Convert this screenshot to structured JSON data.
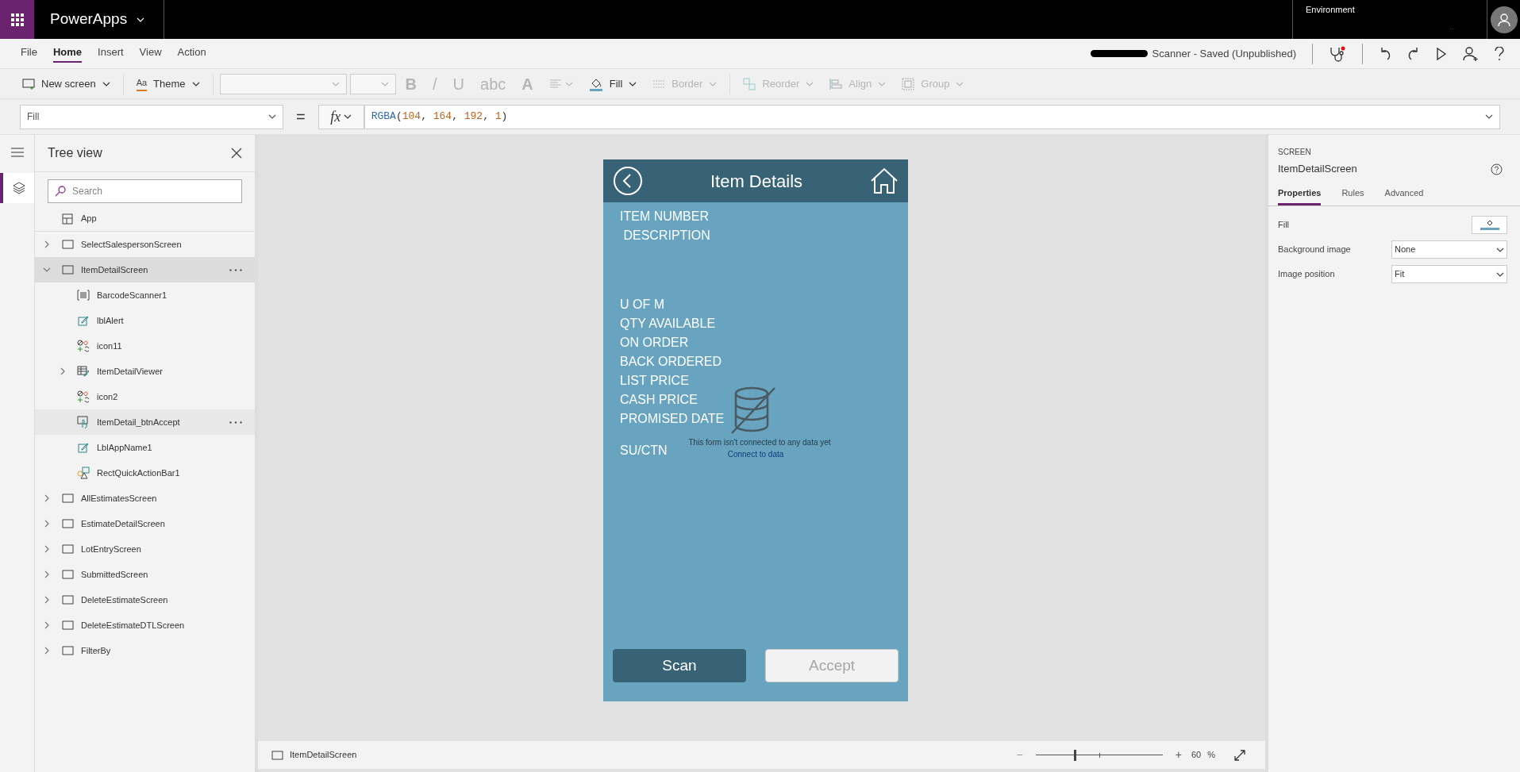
{
  "app_bar": {
    "title": "PowerApps",
    "environment_label": "Environment",
    "environment_value": "..."
  },
  "menu": [
    {
      "label": "File",
      "selected": false
    },
    {
      "label": "Home",
      "selected": true
    },
    {
      "label": "Insert",
      "selected": false
    },
    {
      "label": "View",
      "selected": false
    },
    {
      "label": "Action",
      "selected": false
    }
  ],
  "save_status": "Scanner - Saved (Unpublished)",
  "toolbar": [
    {
      "kind": "new-screen",
      "label": "New screen",
      "disabled": false
    },
    {
      "kind": "theme",
      "label": "Theme",
      "icon_text": "Aa",
      "disabled": false
    },
    {
      "kind": "font-select",
      "disabled": true
    },
    {
      "kind": "size-select",
      "disabled": true
    },
    {
      "kind": "glyph",
      "label": "B",
      "disabled": true
    },
    {
      "kind": "glyph",
      "label": "/",
      "disabled": true
    },
    {
      "kind": "glyph",
      "label": "U",
      "disabled": true
    },
    {
      "kind": "glyph",
      "label": "abc",
      "disabled": true
    },
    {
      "kind": "glyph",
      "label": "A",
      "disabled": true
    },
    {
      "kind": "align-text",
      "disabled": true
    },
    {
      "kind": "fill",
      "label": "Fill",
      "disabled": false
    },
    {
      "kind": "border",
      "label": "Border",
      "disabled": true
    },
    {
      "kind": "reorder",
      "label": "Reorder",
      "disabled": true
    },
    {
      "kind": "align",
      "label": "Align",
      "disabled": true
    },
    {
      "kind": "group",
      "label": "Group",
      "disabled": true
    }
  ],
  "formula_bar": {
    "property": "Fill",
    "equals": "=",
    "fx": "fx",
    "formula": [
      {
        "text": "RGBA",
        "kind": "function"
      },
      {
        "text": "(",
        "kind": "punct"
      },
      {
        "text": "104",
        "kind": "number"
      },
      {
        "text": ", ",
        "kind": "punct"
      },
      {
        "text": "164",
        "kind": "number"
      },
      {
        "text": ", ",
        "kind": "punct"
      },
      {
        "text": "192",
        "kind": "number"
      },
      {
        "text": ", ",
        "kind": "punct"
      },
      {
        "text": "1",
        "kind": "number"
      },
      {
        "text": ")",
        "kind": "punct"
      }
    ]
  },
  "tree_view": {
    "title": "Tree view",
    "search_placeholder": "Search",
    "items": [
      {
        "label": "App",
        "kind": "app",
        "selected": false,
        "hovered": false
      },
      {
        "label": "SelectSalespersonScreen",
        "kind": "screen",
        "expanded": false,
        "selected": false,
        "hovered": false
      },
      {
        "label": "ItemDetailScreen",
        "kind": "screen",
        "expanded": true,
        "selected": true,
        "hovered": false,
        "children": [
          {
            "label": "BarcodeScanner1",
            "kind": "barcode",
            "selected": false,
            "hovered": false
          },
          {
            "label": "lblAlert",
            "kind": "label",
            "selected": false,
            "hovered": false
          },
          {
            "label": "icon11",
            "kind": "icons",
            "selected": false,
            "hovered": false
          },
          {
            "label": "ItemDetailViewer",
            "kind": "form",
            "expanded": false,
            "selected": false,
            "hovered": false
          },
          {
            "label": "icon2",
            "kind": "icons",
            "selected": false,
            "hovered": false
          },
          {
            "label": "ItemDetail_btnAccept",
            "kind": "button",
            "selected": false,
            "hovered": true
          },
          {
            "label": "LblAppName1",
            "kind": "label",
            "selected": false,
            "hovered": false
          },
          {
            "label": "RectQuickActionBar1",
            "kind": "shape",
            "selected": false,
            "hovered": false
          }
        ]
      },
      {
        "label": "AllEstimatesScreen",
        "kind": "screen",
        "expanded": false,
        "selected": false,
        "hovered": false
      },
      {
        "label": "EstimateDetailScreen",
        "kind": "screen",
        "expanded": false,
        "selected": false,
        "hovered": false
      },
      {
        "label": "LotEntryScreen",
        "kind": "screen",
        "expanded": false,
        "selected": false,
        "hovered": false
      },
      {
        "label": "SubmittedScreen",
        "kind": "screen",
        "expanded": false,
        "selected": false,
        "hovered": false
      },
      {
        "label": "DeleteEstimateScreen",
        "kind": "screen",
        "expanded": false,
        "selected": false,
        "hovered": false
      },
      {
        "label": "DeleteEstimateDTLScreen",
        "kind": "screen",
        "expanded": false,
        "selected": false,
        "hovered": false
      },
      {
        "label": "FilterBy",
        "kind": "screen",
        "expanded": false,
        "selected": false,
        "hovered": false
      }
    ]
  },
  "phone": {
    "title": "Item Details",
    "field_groups": [
      [
        "ITEM NUMBER",
        " DESCRIPTION"
      ],
      [
        "U OF M",
        "QTY AVAILABLE",
        "ON ORDER",
        "BACK ORDERED",
        "LIST PRICE",
        "CASH PRICE",
        "PROMISED DATE"
      ],
      [
        "SU/CTN"
      ]
    ],
    "empty_form": {
      "message": "This form isn't connected to any data yet",
      "link": "Connect to data"
    },
    "buttons": [
      {
        "label": "Scan",
        "disabled": false
      },
      {
        "label": "Accept",
        "disabled": true
      }
    ]
  },
  "properties_panel": {
    "type": "SCREEN",
    "name": "ItemDetailScreen",
    "tabs": [
      {
        "label": "Properties",
        "selected": true
      },
      {
        "label": "Rules",
        "selected": false
      },
      {
        "label": "Advanced",
        "selected": false
      }
    ],
    "fill": {
      "label": "Fill",
      "color": "#68a4c0"
    },
    "rows": [
      {
        "label": "Background image",
        "value": "None"
      },
      {
        "label": "Image position",
        "value": "Fit"
      }
    ]
  },
  "status_bar": {
    "screen": "ItemDetailScreen",
    "zoom": {
      "level": 0.31
    },
    "plus": "+",
    "minus": "−",
    "zoom_value": "60",
    "zoom_unit": "%"
  }
}
